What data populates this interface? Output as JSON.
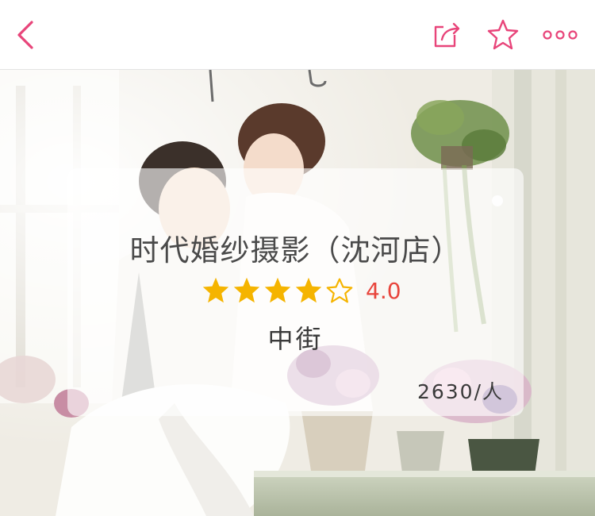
{
  "header": {
    "back_icon": "chevron-left-icon",
    "share_icon": "share-icon",
    "favorite_icon": "star-outline-icon",
    "more_icon": "more-dots-icon",
    "accent_color": "#e8457a"
  },
  "hero": {
    "image": "wedding-photo"
  },
  "shop": {
    "name": "时代婚纱摄影（沈河店）",
    "rating": 4.0,
    "rating_text": "4.0",
    "stars_filled": 4,
    "stars_total": 5,
    "district": "中街",
    "visitors": "2630/人",
    "star_color": "#f5b400",
    "rating_color": "#e8453c"
  }
}
